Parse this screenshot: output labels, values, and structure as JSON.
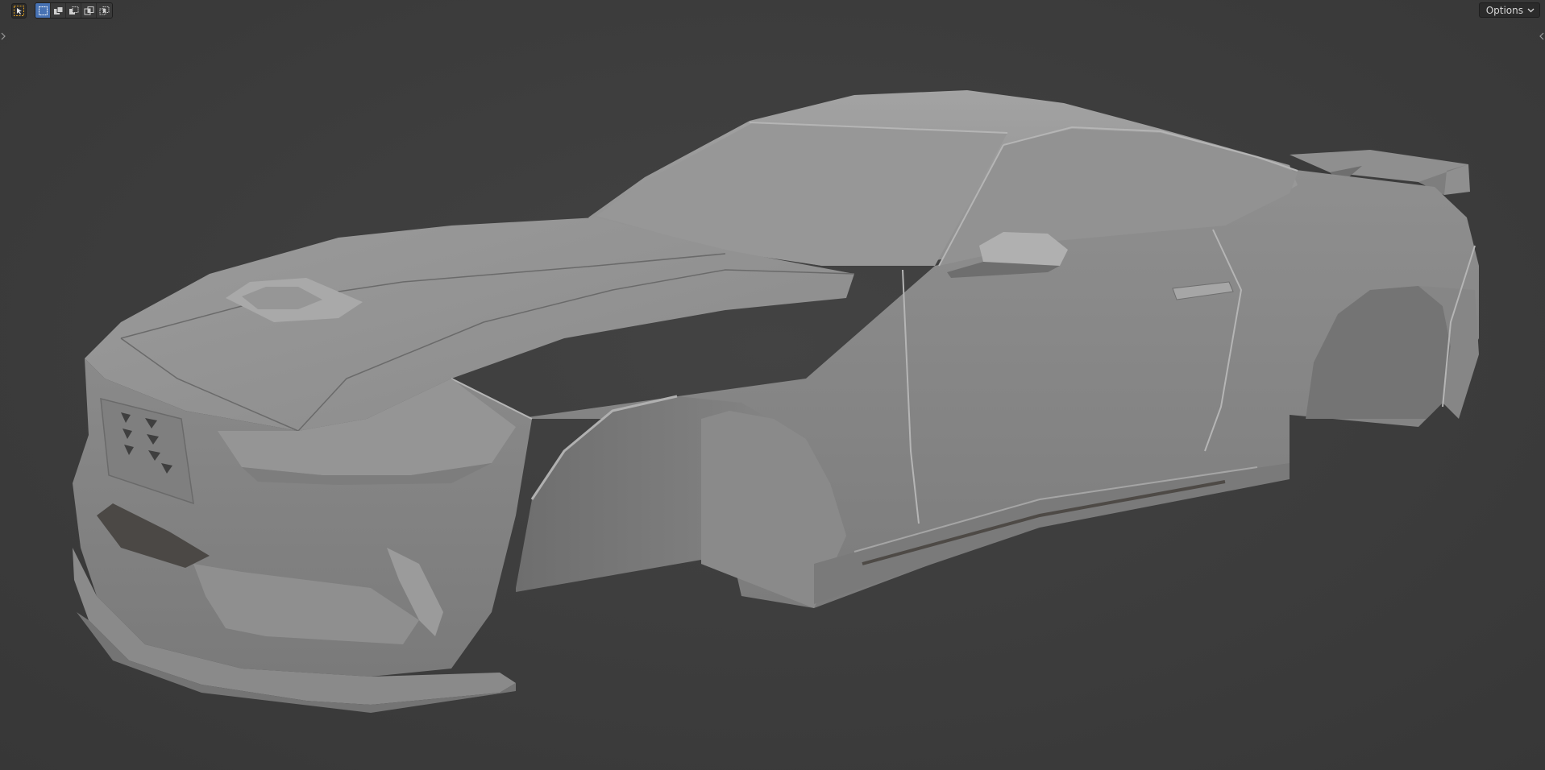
{
  "header": {
    "options_label": "Options",
    "tools": [
      {
        "name": "select-tool",
        "icon": "cursor-select-icon",
        "active": true
      },
      {
        "name": "mode-new",
        "icon": "select-new-icon",
        "selected": true
      },
      {
        "name": "mode-extend",
        "icon": "select-extend-icon",
        "selected": false
      },
      {
        "name": "mode-subtract",
        "icon": "select-subtract-icon",
        "selected": false
      },
      {
        "name": "mode-invert",
        "icon": "select-invert-icon",
        "selected": false
      },
      {
        "name": "mode-intersect",
        "icon": "select-intersect-icon",
        "selected": false
      }
    ]
  },
  "viewport": {
    "object": "car-body-model",
    "shading": "solid",
    "colors": {
      "background": "#3d3d3d",
      "body": "#8c8c8c",
      "highlight": "#a8a8a8",
      "shadow": "#6a6a6a",
      "accent_selected": "#4772b3"
    }
  },
  "sidebars": {
    "left_toggle_icon": "chevron-right-icon",
    "right_toggle_icon": "chevron-left-icon"
  }
}
